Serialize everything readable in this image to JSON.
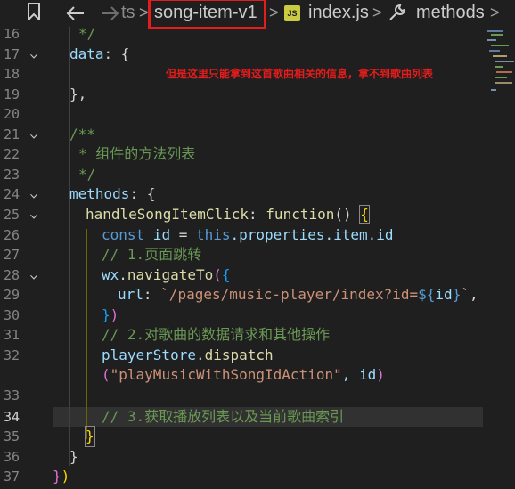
{
  "breadcrumb": {
    "ts": "ts",
    "folder": "song-item-v1",
    "file_badge": "JS",
    "file": "index.js",
    "symbol": "methods"
  },
  "annotation": "但是这里只能拿到这首歌曲相关的信息，拿不到歌曲列表",
  "code": {
    "l16": "*/",
    "l17_key": "data",
    "l17_rest": ": {",
    "l19": "},",
    "l21": "/**",
    "l22": "* 组件的方法列表",
    "l23": "*/",
    "l24_key": "methods",
    "l24_rest": ": {",
    "l25_fn": "handleSongItemClick",
    "l25_colon": ": ",
    "l25_kw": "function",
    "l25_paren": "() ",
    "l25_brace": "{",
    "l26_kw": "const",
    "l26_var": " id",
    "l26_eq": " = ",
    "l26_this": "this",
    "l26_rest": ".properties.item.id",
    "l27": "// 1.页面跳转",
    "l28_obj": "wx",
    "l28_dot": ".",
    "l28_fn": "navigateTo",
    "l28_paren": "(",
    "l28_brace": "{",
    "l29_key": "url",
    "l29_colon": ": ",
    "l29_str1": "`/pages/music-player/index?id=",
    "l29_tpl": "${",
    "l29_var": "id",
    "l29_tpl_end": "}",
    "l29_str2": "`",
    "l29_comma": ",",
    "l30_brace": "}",
    "l30_paren": ")",
    "l31": "// 2.对歌曲的数据请求和其他操作",
    "l32_obj": "playerStore",
    "l32_dot": ".",
    "l32_fn": "dispatch",
    "l32b_paren": "(",
    "l32b_str": "\"playMusicWithSongIdAction\"",
    "l32b_rest": ", id",
    "l32b_paren_end": ")",
    "l34": "// 3.获取播放列表以及当前歌曲索引",
    "l35": "}",
    "l36": "}",
    "l37_brace": "}",
    "l37_paren": ")"
  },
  "line_numbers": [
    "16",
    "17",
    "18",
    "19",
    "20",
    "21",
    "22",
    "23",
    "24",
    "25",
    "26",
    "27",
    "28",
    "29",
    "30",
    "31",
    "32",
    "33",
    "34",
    "35",
    "36",
    "37"
  ],
  "colors": {
    "background": "#1f1f1f",
    "keyword": "#569cd6",
    "property": "#9cdcfe",
    "function": "#dcdcaa",
    "string": "#ce9178",
    "comment": "#6a9955",
    "annotation_red": "#e51c1c"
  },
  "icons": [
    "bookmark-icon",
    "back-arrow-icon",
    "forward-arrow-icon",
    "wrench-icon",
    "chevron-right-icon",
    "fold-chevron-icon"
  ]
}
